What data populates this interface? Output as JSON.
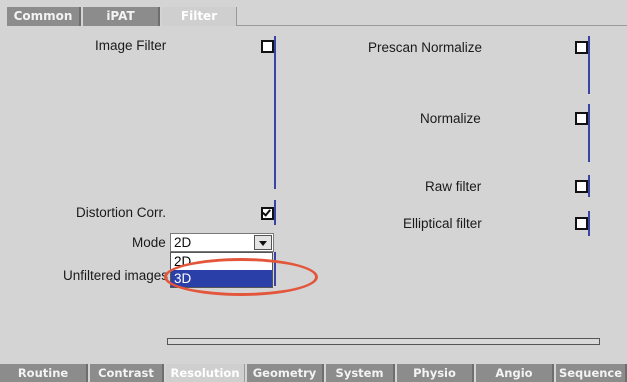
{
  "top_tabs": [
    {
      "label": "Common",
      "active": false
    },
    {
      "label": "iPAT",
      "active": false
    },
    {
      "label": "Filter",
      "active": true
    }
  ],
  "left_column": {
    "image_filter": {
      "label": "Image Filter",
      "checked": false
    },
    "distortion_corr": {
      "label": "Distortion Corr.",
      "checked": true
    },
    "mode": {
      "label": "Mode",
      "selected": "2D",
      "options": [
        "2D",
        "3D"
      ],
      "highlighted": "3D"
    },
    "unfiltered_images": {
      "label": "Unfiltered images"
    }
  },
  "right_column": {
    "prescan_normalize": {
      "label": "Prescan Normalize",
      "checked": false
    },
    "normalize": {
      "label": "Normalize",
      "checked": false
    },
    "raw_filter": {
      "label": "Raw filter",
      "checked": false
    },
    "elliptical_filter": {
      "label": "Elliptical filter",
      "checked": false
    }
  },
  "progress": {
    "value": 0
  },
  "bottom_tabs": [
    {
      "label": "Routine",
      "active": false
    },
    {
      "label": "Contrast",
      "active": false
    },
    {
      "label": "Resolution",
      "active": true
    },
    {
      "label": "Geometry",
      "active": false
    },
    {
      "label": "System",
      "active": false
    },
    {
      "label": "Physio",
      "active": false
    },
    {
      "label": "Angio",
      "active": false
    },
    {
      "label": "Sequence",
      "active": false
    }
  ],
  "colors": {
    "accent_blue": "#3a44a6",
    "highlight": "#2b3fa8",
    "annotation_red": "#e4563b",
    "tab_gray": "#8c8c8c",
    "panel_bg": "#d4d4d4"
  }
}
